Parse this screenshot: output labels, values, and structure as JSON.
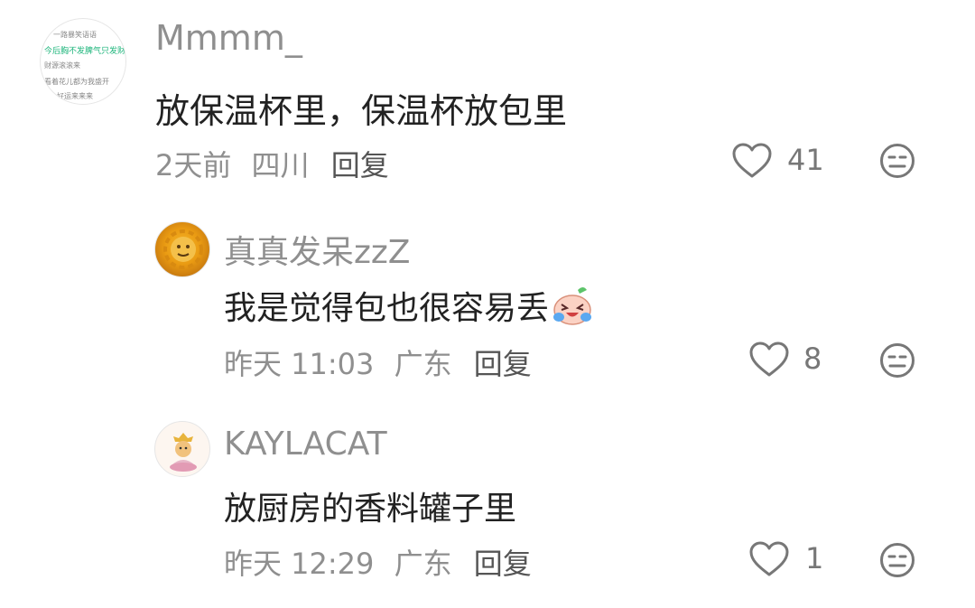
{
  "comments": [
    {
      "author": "Mmmm_",
      "text": "放保温杯里，保温杯放包里",
      "time": "2天前",
      "location": "四川",
      "reply_label": "回复",
      "likes": "41"
    },
    {
      "author": "真真发呆zzZ",
      "text": "我是觉得包也很容易丢",
      "time": "昨天 11:03",
      "location": "广东",
      "reply_label": "回复",
      "likes": "8"
    },
    {
      "author": "KAYLACAT",
      "text": "放厨房的香料罐子里",
      "time": "昨天 12:29",
      "location": "广东",
      "reply_label": "回复",
      "likes": "1"
    }
  ],
  "avatar1_lines": [
    "一路暴笑语语",
    "今后胸不发脾气只发财",
    "财源滚滚来",
    "看着花儿都为我盛开",
    "好运来来来"
  ],
  "icons": {
    "like": "heart-outline-icon",
    "dislike": "neutral-face-icon",
    "emoji": "crying-laughing-emoji-icon"
  },
  "colors": {
    "author": "#8f8f8f",
    "text": "#222222",
    "meta": "#8f8f8f",
    "icon": "#777777",
    "avatar_green": "#1db57b"
  }
}
